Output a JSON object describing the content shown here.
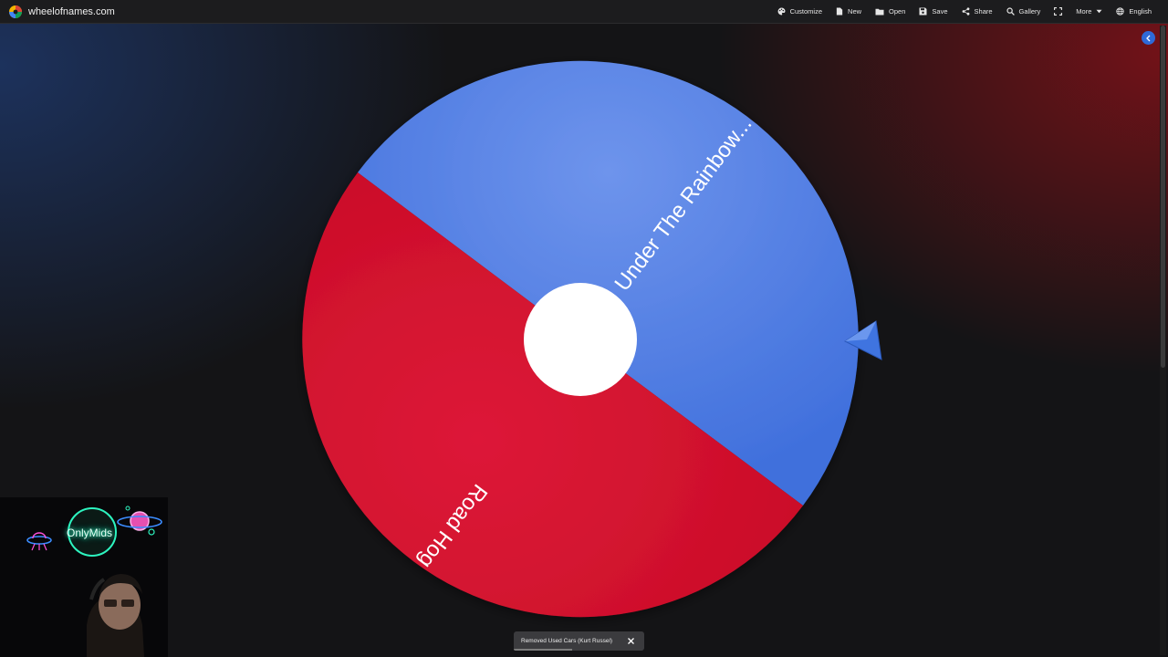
{
  "app": {
    "site_name": "wheelofnames.com"
  },
  "menu": {
    "items": [
      {
        "label": "Customize",
        "icon": "palette-icon"
      },
      {
        "label": "New",
        "icon": "file-icon"
      },
      {
        "label": "Open",
        "icon": "folder-icon"
      },
      {
        "label": "Save",
        "icon": "save-icon"
      },
      {
        "label": "Share",
        "icon": "share-icon"
      },
      {
        "label": "Gallery",
        "icon": "search-icon"
      },
      {
        "label": "",
        "icon": "fullscreen-icon"
      },
      {
        "label": "More",
        "icon": "chevron-down-icon"
      },
      {
        "label": "English",
        "icon": "globe-icon"
      }
    ]
  },
  "wheel": {
    "slices": [
      {
        "label": "Under The Rainbow...",
        "color": "#4a7ee6"
      },
      {
        "label": "Road Hog",
        "color": "#d2102c"
      }
    ],
    "pointer_color": "#3f74e0"
  },
  "overlay": {
    "logo_text": "OnlyMids"
  },
  "toast": {
    "message": "Removed Used Cars (Kurt Russel)",
    "progress": 0.45
  },
  "colors": {
    "accent": "#2e6ad8",
    "topbar": "#1c1c1e"
  }
}
